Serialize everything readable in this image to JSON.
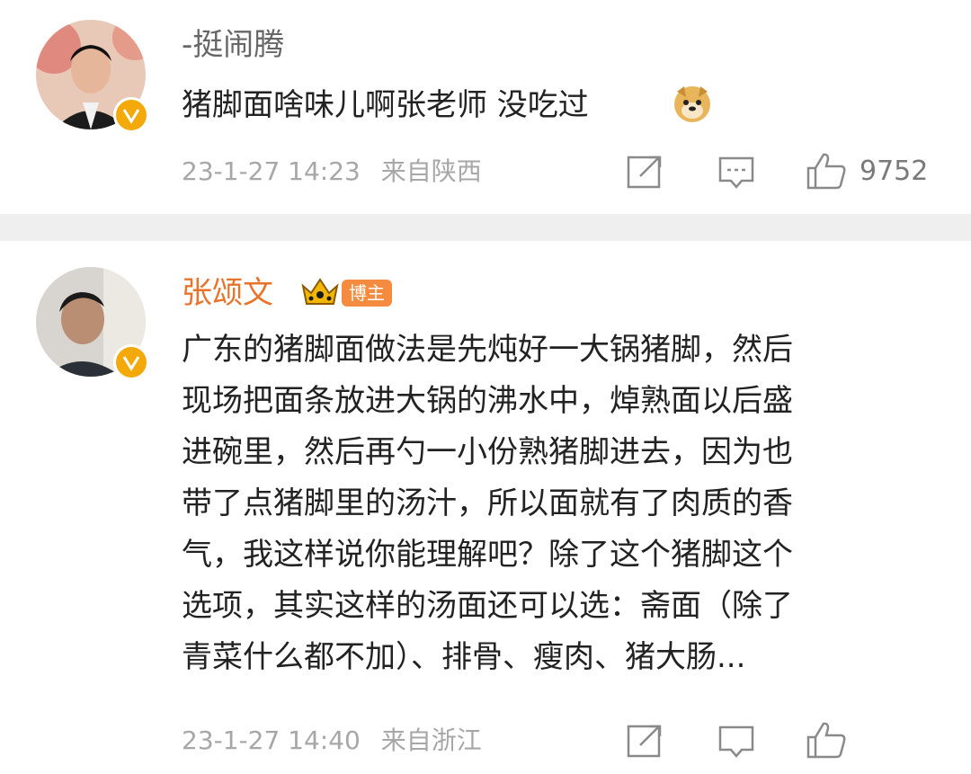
{
  "comments": [
    {
      "username": "-挺闹腾",
      "text": "猪脚面啥味儿啊张老师 没吃过",
      "emoji": "doge-emoji",
      "time": "23-1-27 14:23",
      "location": "来自陕西",
      "likes": "9752",
      "verified": true
    },
    {
      "username": "张颂文",
      "badge": "博主",
      "crown": "crown-icon",
      "lines": [
        "广东的猪脚面做法是先炖好一大锅猪脚，然后",
        "现场把面条放进大锅的沸水中，焯熟面以后盛",
        "进碗里，然后再勺一小份熟猪脚进去，因为也",
        "带了点猪脚里的汤汁，所以面就有了肉质的香",
        "气，我这样说你能理解吧？除了这个猪脚这个",
        "选项，其实这样的汤面还可以选：斋面（除了",
        "青菜什么都不加）、排骨、瘦肉、猪大肠..."
      ],
      "time": "23-1-27 14:40",
      "location": "来自浙江",
      "verified": true
    }
  ],
  "colors": {
    "author_name": "#e8742c",
    "badge_bg": "#f48b3e",
    "verified": "#f4a90b",
    "meta": "#a7a7a7",
    "divider": "#efefef"
  }
}
